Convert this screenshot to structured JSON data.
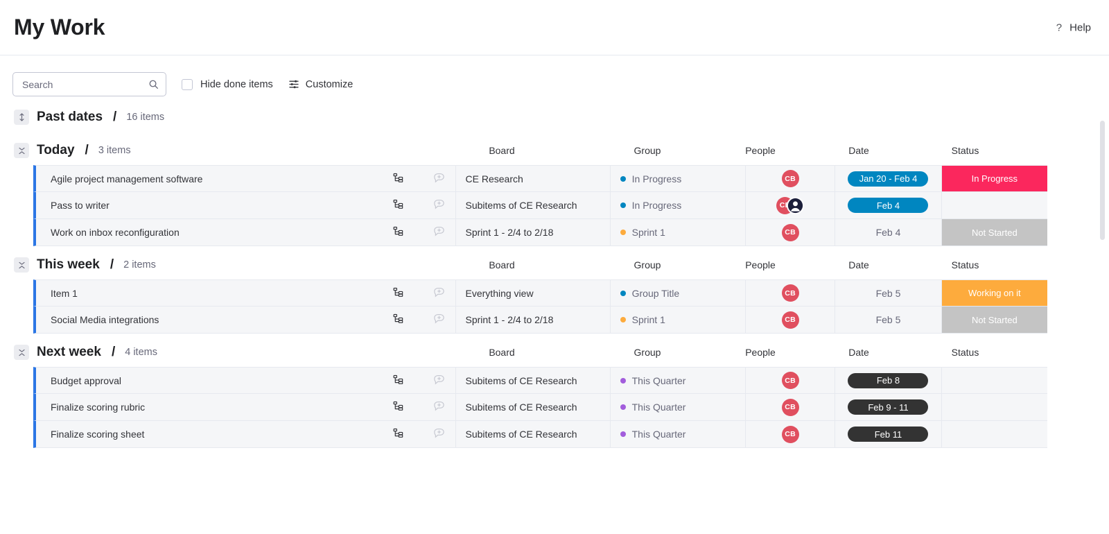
{
  "header": {
    "title": "My Work",
    "help_label": "Help",
    "help_icon": "question-mark-icon"
  },
  "toolbar": {
    "search_placeholder": "Search",
    "search_value": "",
    "search_icon": "search-icon",
    "hide_done_label": "Hide done items",
    "hide_done_checked": false,
    "customize_label": "Customize",
    "customize_icon": "sliders-icon"
  },
  "columns": [
    "Board",
    "Group",
    "People",
    "Date",
    "Status"
  ],
  "colors": {
    "accent_blue": "#2b76e5",
    "dot_blue": "#0086c0",
    "dot_orange": "#fdab3d",
    "dot_purple": "#a25ddc",
    "status_in_progress": "#fb275d",
    "status_not_started": "#c4c4c4",
    "status_working_on_it": "#fdab3d",
    "date_blue": "#0086c0",
    "date_dark": "#333333",
    "avatar_red": "#e04f5f",
    "row_bg": "#f5f6f8",
    "grid_border": "#e6e9ef"
  },
  "groups": [
    {
      "id": "past-dates",
      "title": "Past dates",
      "count": "16 items",
      "collapsed": true,
      "collapse_icon": "expand-vertical-icon",
      "show_columns": false,
      "rows": []
    },
    {
      "id": "today",
      "title": "Today",
      "count": "3 items",
      "collapsed": false,
      "collapse_icon": "collapse-vertical-icon",
      "show_columns": true,
      "rows": [
        {
          "name": "Agile project management software",
          "subitem_icon": "subitems-icon",
          "comment_icon": "add-comment-icon",
          "board": "CE Research",
          "group": "In Progress",
          "group_dot": "#0086c0",
          "people": [
            "CB"
          ],
          "people_extra": false,
          "date": "Jan 20 - Feb 4",
          "date_style": "pill-blue",
          "status": "In Progress",
          "status_color": "#fb275d"
        },
        {
          "name": "Pass to writer",
          "subitem_icon": "subitems-icon",
          "comment_icon": "add-comment-icon",
          "board": "Subitems of CE Research",
          "group": "In Progress",
          "group_dot": "#0086c0",
          "people": [
            "CB"
          ],
          "people_extra": true,
          "date": "Feb 4",
          "date_style": "pill-blue",
          "status": "",
          "status_color": ""
        },
        {
          "name": "Work on inbox reconfiguration",
          "subitem_icon": "subitems-icon",
          "comment_icon": "add-comment-icon",
          "board": "Sprint 1 - 2/4 to 2/18",
          "group": "Sprint 1",
          "group_dot": "#fdab3d",
          "people": [
            "CB"
          ],
          "people_extra": false,
          "date": "Feb 4",
          "date_style": "plain",
          "status": "Not Started",
          "status_color": "#c4c4c4"
        }
      ]
    },
    {
      "id": "this-week",
      "title": "This week",
      "count": "2 items",
      "collapsed": false,
      "collapse_icon": "collapse-vertical-icon",
      "show_columns": true,
      "rows": [
        {
          "name": "Item 1",
          "subitem_icon": "subitems-icon",
          "comment_icon": "add-comment-icon",
          "board": "Everything view",
          "group": "Group Title",
          "group_dot": "#0086c0",
          "people": [
            "CB"
          ],
          "people_extra": false,
          "date": "Feb 5",
          "date_style": "plain",
          "status": "Working on it",
          "status_color": "#fdab3d"
        },
        {
          "name": "Social Media integrations",
          "subitem_icon": "subitems-icon",
          "comment_icon": "add-comment-icon",
          "board": "Sprint 1 - 2/4 to 2/18",
          "group": "Sprint 1",
          "group_dot": "#fdab3d",
          "people": [
            "CB"
          ],
          "people_extra": false,
          "date": "Feb 5",
          "date_style": "plain",
          "status": "Not Started",
          "status_color": "#c4c4c4"
        }
      ]
    },
    {
      "id": "next-week",
      "title": "Next week",
      "count": "4 items",
      "collapsed": false,
      "collapse_icon": "collapse-vertical-icon",
      "show_columns": true,
      "rows": [
        {
          "name": "Budget approval",
          "subitem_icon": "subitems-icon",
          "comment_icon": "add-comment-icon",
          "board": "Subitems of CE Research",
          "group": "This Quarter",
          "group_dot": "#a25ddc",
          "people": [
            "CB"
          ],
          "people_extra": false,
          "date": "Feb 8",
          "date_style": "pill-dark",
          "status": "",
          "status_color": ""
        },
        {
          "name": "Finalize scoring rubric",
          "subitem_icon": "subitems-icon",
          "comment_icon": "add-comment-icon",
          "board": "Subitems of CE Research",
          "group": "This Quarter",
          "group_dot": "#a25ddc",
          "people": [
            "CB"
          ],
          "people_extra": false,
          "date": "Feb 9 - 11",
          "date_style": "pill-dark",
          "status": "",
          "status_color": ""
        },
        {
          "name": "Finalize scoring sheet",
          "subitem_icon": "subitems-icon",
          "comment_icon": "add-comment-icon",
          "board": "Subitems of CE Research",
          "group": "This Quarter",
          "group_dot": "#a25ddc",
          "people": [
            "CB"
          ],
          "people_extra": false,
          "date": "Feb 11",
          "date_style": "pill-dark",
          "status": "",
          "status_color": ""
        }
      ]
    }
  ]
}
